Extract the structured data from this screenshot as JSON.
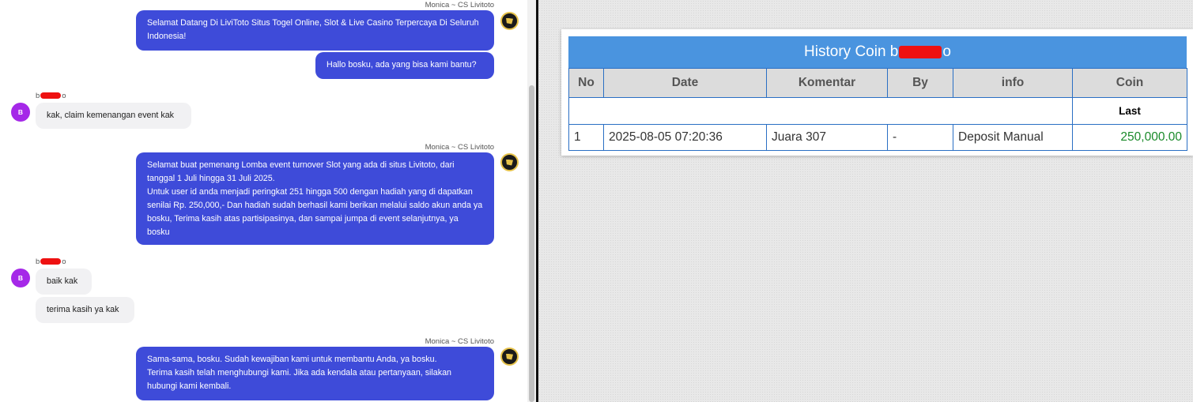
{
  "chat": {
    "agent_name": "Monica ~ CS Livitoto",
    "user_name_prefix": "b",
    "user_name_suffix": "o",
    "user_avatar_letter": "B",
    "messages": [
      {
        "from": "agent",
        "text": "Selamat Datang Di LiviToto Situs Togel Online, Slot & Live Casino Terpercaya Di Seluruh Indonesia!"
      },
      {
        "from": "agent",
        "text": "Hallo bosku, ada yang bisa kami bantu?"
      },
      {
        "from": "user",
        "text": "kak, claim kemenangan event kak"
      },
      {
        "from": "agent",
        "text": "Selamat buat pemenang Lomba event turnover Slot yang ada di situs Livitoto, dari tanggal 1 Juli hingga 31 Juli 2025.\nUntuk user id anda menjadi peringkat 251 hingga 500 dengan hadiah yang di dapatkan senilai Rp. 250,000,- Dan hadiah sudah berhasil kami berikan melalui saldo akun anda ya bosku, Terima kasih atas partisipasinya, dan sampai jumpa di event selanjutnya, ya bosku"
      },
      {
        "from": "user",
        "text": "baik kak"
      },
      {
        "from": "user",
        "text": "terima kasih ya kak"
      },
      {
        "from": "agent",
        "text": "Sama-sama, bosku. Sudah kewajiban kami untuk membantu Anda, ya bosku.\nTerima kasih telah menghubungi kami. Jika ada kendala atau pertanyaan, silakan hubungi kami kembali."
      }
    ]
  },
  "history": {
    "title_prefix": "History Coin b",
    "title_suffix": "o",
    "columns": [
      "No",
      "Date",
      "Komentar",
      "By",
      "info",
      "Coin"
    ],
    "last_label": "Last",
    "rows": [
      {
        "no": "1",
        "date": "2025-08-05 07:20:36",
        "komentar": "Juara 307",
        "by": "-",
        "info": "Deposit Manual",
        "coin": "250,000.00"
      }
    ]
  },
  "colors": {
    "agent_bubble": "#3e4bd9",
    "user_avatar": "#a528e8",
    "header_bar": "#4a94df",
    "coin_value": "#1a8a2a",
    "redaction": "#ee1111"
  },
  "icons": {
    "agent_avatar": "livitoto-logo-icon",
    "user_avatar": "user-initial-avatar"
  }
}
